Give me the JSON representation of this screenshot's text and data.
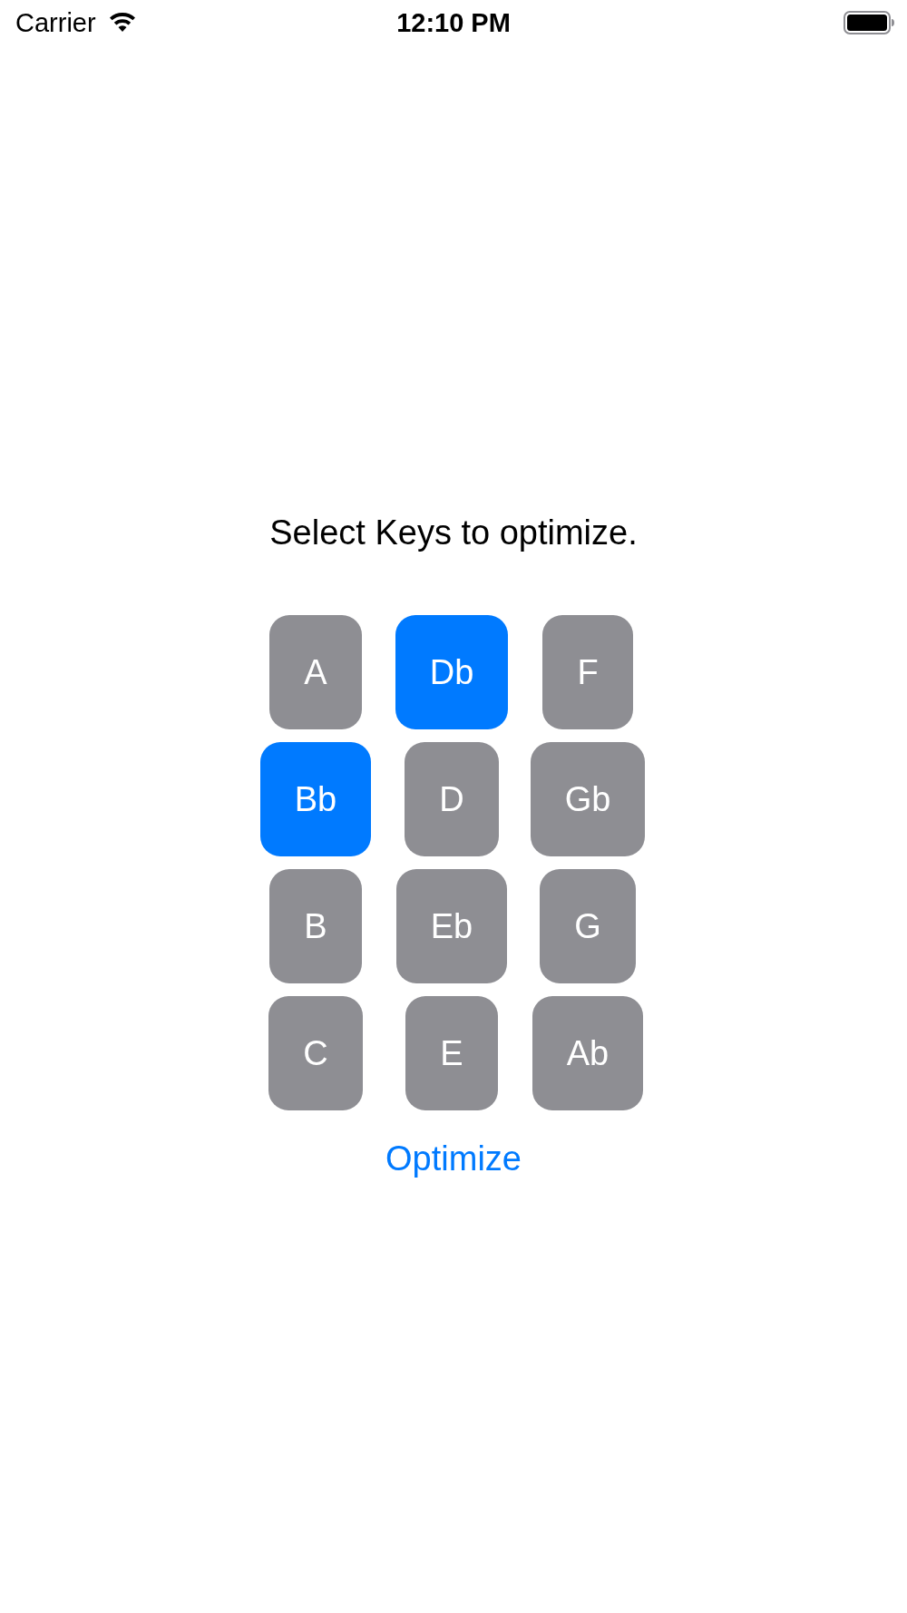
{
  "status_bar": {
    "carrier": "Carrier",
    "time": "12:10 PM"
  },
  "prompt": "Select Keys to optimize.",
  "keys": [
    {
      "label": "A",
      "selected": false
    },
    {
      "label": "Db",
      "selected": true
    },
    {
      "label": "F",
      "selected": false
    },
    {
      "label": "Bb",
      "selected": true
    },
    {
      "label": "D",
      "selected": false
    },
    {
      "label": "Gb",
      "selected": false
    },
    {
      "label": "B",
      "selected": false
    },
    {
      "label": "Eb",
      "selected": false
    },
    {
      "label": "G",
      "selected": false
    },
    {
      "label": "C",
      "selected": false
    },
    {
      "label": "E",
      "selected": false
    },
    {
      "label": "Ab",
      "selected": false
    }
  ],
  "action": {
    "label": "Optimize"
  }
}
